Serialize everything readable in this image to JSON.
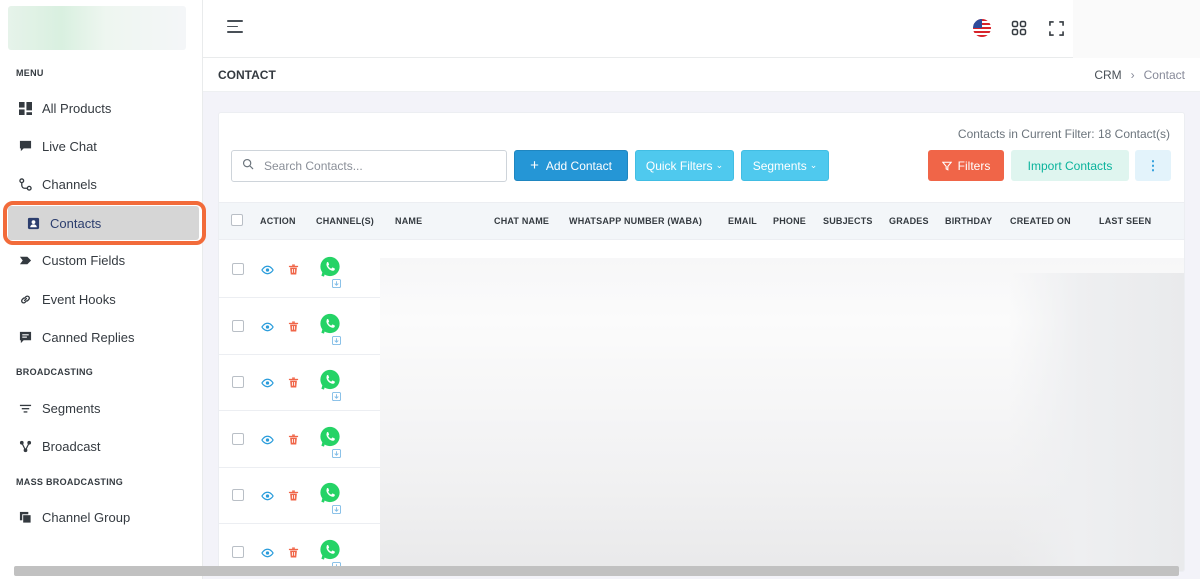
{
  "sidebar": {
    "menu_heading": "MENU",
    "items": [
      {
        "label": "All Products",
        "icon": "grid-icon"
      },
      {
        "label": "Live Chat",
        "icon": "chat-icon"
      },
      {
        "label": "Channels",
        "icon": "route-icon"
      },
      {
        "label": "Contacts",
        "icon": "contact-card-icon",
        "active": true
      },
      {
        "label": "Custom Fields",
        "icon": "tag-icon"
      },
      {
        "label": "Event Hooks",
        "icon": "link-icon"
      },
      {
        "label": "Canned Replies",
        "icon": "message-square-icon"
      }
    ],
    "broadcasting_heading": "BROADCASTING",
    "broadcasting_items": [
      {
        "label": "Segments",
        "icon": "filter-lines-icon"
      },
      {
        "label": "Broadcast",
        "icon": "nodes-icon"
      }
    ],
    "mass_heading": "MASS BROADCASTING",
    "mass_items": [
      {
        "label": "Channel Group",
        "icon": "copy-icon"
      }
    ]
  },
  "page": {
    "title": "CONTACT",
    "breadcrumb": [
      "CRM",
      "Contact"
    ]
  },
  "toolbar": {
    "filter_count": "Contacts in Current Filter: 18 Contact(s)",
    "search_placeholder": "Search Contacts...",
    "add_contact": "Add Contact",
    "quick_filters": "Quick Filters",
    "segments": "Segments",
    "filters": "Filters",
    "import_contacts": "Import Contacts"
  },
  "table": {
    "columns": [
      "ACTION",
      "CHANNEL(S)",
      "NAME",
      "CHAT NAME",
      "WHATSAPP NUMBER (WABA)",
      "EMAIL",
      "PHONE",
      "SUBJECTS",
      "GRADES",
      "BIRTHDAY",
      "CREATED ON",
      "LAST SEEN"
    ],
    "row_count": 6
  },
  "colors": {
    "accent": "#2596d6",
    "info": "#4fc9ee",
    "danger": "#f06548",
    "success": "#0ab39c",
    "whatsapp": "#25d366",
    "highlight": "#f26b3a"
  }
}
